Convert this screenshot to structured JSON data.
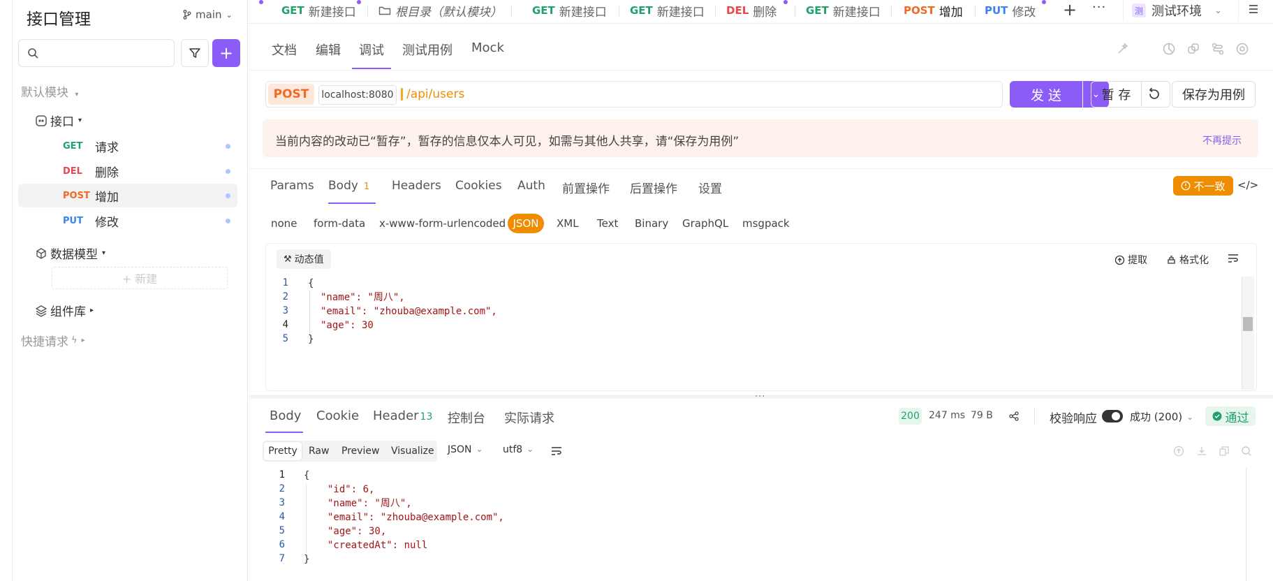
{
  "sidebar": {
    "title": "接口管理",
    "branch": "main",
    "search_placeholder": "",
    "default_module": "默认模块",
    "api_group": "接口",
    "endpoints": [
      {
        "method": "GET",
        "name": "请求"
      },
      {
        "method": "DEL",
        "name": "删除"
      },
      {
        "method": "POST",
        "name": "增加"
      },
      {
        "method": "PUT",
        "name": "修改"
      }
    ],
    "data_model": "数据模型",
    "new_label": "+ 新建",
    "component_lib": "组件库",
    "quick_request": "快捷请求"
  },
  "tabs": [
    {
      "method": "GET",
      "label": "新建接口"
    },
    {
      "method": "",
      "label": "根目录（默认模块）"
    },
    {
      "method": "GET",
      "label": "新建接口"
    },
    {
      "method": "GET",
      "label": "新建接口"
    },
    {
      "method": "DEL",
      "label": "删除"
    },
    {
      "method": "GET",
      "label": "新建接口"
    },
    {
      "method": "POST",
      "label": "增加"
    },
    {
      "method": "PUT",
      "label": "修改"
    }
  ],
  "environment": "测试环境",
  "env_badge": "测",
  "sub_tabs": [
    "文档",
    "编辑",
    "调试",
    "测试用例",
    "Mock"
  ],
  "request": {
    "method": "POST",
    "host": "localhost:8080",
    "path": "/api/users",
    "send": "发 送",
    "save_temp": "暂 存",
    "save_case": "保存为用例"
  },
  "notice": {
    "text": "当前内容的改动已“暂存”，暂存的信息仅本人可见，如需与其他人共享，请“保存为用例”",
    "dismiss": "不再提示"
  },
  "param_tabs": [
    "Params",
    "Body",
    "Headers",
    "Cookies",
    "Auth",
    "前置操作",
    "后置操作",
    "设置"
  ],
  "body_count": "1",
  "inconsistent": "不一致",
  "body_types": [
    "none",
    "form-data",
    "x-www-form-urlencoded",
    "JSON",
    "XML",
    "Text",
    "Binary",
    "GraphQL",
    "msgpack"
  ],
  "editor": {
    "dynamic_value": "动态值",
    "extract": "提取",
    "format": "格式化",
    "line_numbers": [
      "1",
      "2",
      "3",
      "4",
      "5"
    ],
    "lines": [
      "{",
      "\"name\": \"周八\",",
      "\"email\": \"zhouba@example.com\",",
      "\"age\": 30",
      "}"
    ]
  },
  "response": {
    "tabs": [
      "Body",
      "Cookie",
      "Header",
      "控制台",
      "实际请求"
    ],
    "header_count": "13",
    "status": "200",
    "time": "247 ms",
    "size": "79 B",
    "validate": "校验响应",
    "success": "成功 (200)",
    "pass": "通过",
    "view_modes": [
      "Pretty",
      "Raw",
      "Preview",
      "Visualize"
    ],
    "format": "JSON",
    "encoding": "utf8",
    "line_numbers": [
      "1",
      "2",
      "3",
      "4",
      "5",
      "6",
      "7"
    ],
    "lines": [
      "{",
      "\"id\": 6,",
      "\"name\": \"周八\",",
      "\"email\": \"zhouba@example.com\",",
      "\"age\": 30,",
      "\"createdAt\": null",
      "}"
    ]
  },
  "colors": {
    "accent": "#8b5cf6",
    "get": "#22a06b",
    "del": "#e5484d",
    "post": "#f06a25",
    "put": "#3b82f6",
    "notice_bg": "#fdf3ec",
    "warn": "#f08c00"
  }
}
